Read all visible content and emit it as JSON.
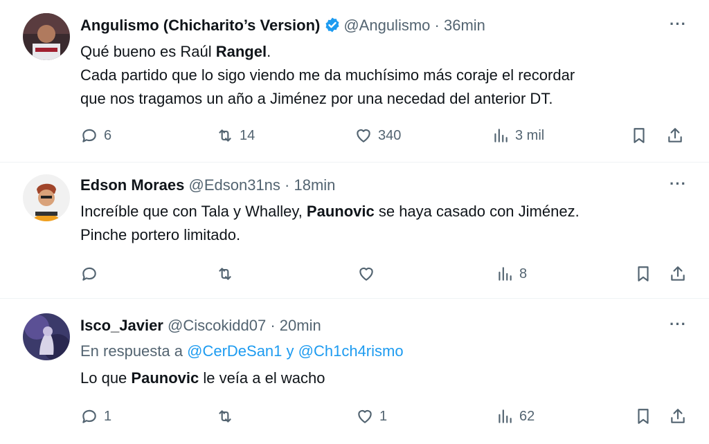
{
  "tweets": [
    {
      "name": "Angulismo (Chicharito’s Version)",
      "verified": true,
      "handle": "@Angulismo",
      "separator": "·",
      "time": "36min",
      "text_parts": [
        "Qué bueno es Raúl ",
        "Rangel",
        "."
      ],
      "line2": "Cada partido que lo sigo viendo me da muchísimo más coraje el recordar",
      "line3": "que nos tragamos un año a Jiménez por una necedad del anterior DT.",
      "replies": "6",
      "retweets": "14",
      "likes": "340",
      "views": "3 mil"
    },
    {
      "name": "Edson Moraes",
      "handle": "@Edson31ns",
      "separator": "·",
      "time": "18min",
      "line1a": "Increíble que con Tala y Whalley, ",
      "line1b": "Paunovic",
      "line1c": " se haya casado con Jiménez.",
      "line2": "Pinche portero limitado.",
      "replies": "",
      "retweets": "",
      "likes": "",
      "views": "8"
    },
    {
      "name": "Isco_Javier",
      "handle": "@Ciscokidd07",
      "separator": "·",
      "time": "20min",
      "reply_prefix": "En respuesta a ",
      "reply_user1": "@CerDeSan1",
      "reply_and": " y ",
      "reply_user2": "@Ch1ch4rismo",
      "line1a": "Lo que ",
      "line1b": "Paunovic",
      "line1c": " le veía a el wacho",
      "replies": "1",
      "retweets": "",
      "likes": "1",
      "views": "62"
    }
  ],
  "more_label": "···",
  "colors": {
    "text": "#0f1419",
    "muted": "#536471",
    "link": "#1d9bf0",
    "verified": "#1d9bf0"
  }
}
